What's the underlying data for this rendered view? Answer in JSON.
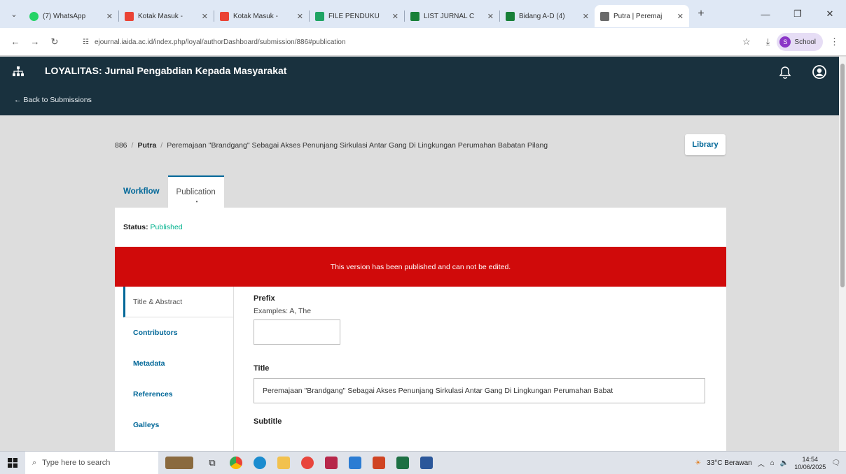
{
  "browser": {
    "tabs": [
      {
        "label": "(7) WhatsApp",
        "color": "#25d366"
      },
      {
        "label": "Kotak Masuk -",
        "color": "#ea4335"
      },
      {
        "label": "Kotak Masuk -",
        "color": "#ea4335"
      },
      {
        "label": "FILE PENDUKU",
        "color": "#1fa463"
      },
      {
        "label": "LIST JURNAL C",
        "color": "#188038"
      },
      {
        "label": "Bidang A-D (4)",
        "color": "#188038"
      },
      {
        "label": "Putra | Peremaj",
        "color": "#6b6b6b"
      }
    ],
    "url": "ejournal.iaida.ac.id/index.php/loyal/authorDashboard/submission/886#publication",
    "profile_label": "School",
    "profile_initial": "S"
  },
  "header": {
    "journal_title": "LOYALITAS: Jurnal Pengabdian Kepada Masyarakat",
    "back_link": "← Back to Submissions"
  },
  "breadcrumb": {
    "id": "886",
    "author": "Putra",
    "title": "Peremajaan \"Brandgang\" Sebagai Akses Penunjang Sirkulasi Antar Gang Di Lingkungan Perumahan Babatan Pilang"
  },
  "library_label": "Library",
  "tabs": {
    "workflow": "Workflow",
    "publication": "Publication"
  },
  "status": {
    "label": "Status:",
    "value": "Published"
  },
  "alert_message": "This version has been published and can not be edited.",
  "sidenav": [
    "Title & Abstract",
    "Contributors",
    "Metadata",
    "References",
    "Galleys"
  ],
  "form": {
    "prefix_label": "Prefix",
    "prefix_desc": "Examples: A, The",
    "prefix_value": "",
    "title_label": "Title",
    "title_value": "Peremajaan \"Brandgang\" Sebagai Akses Penunjang Sirkulasi Antar Gang Di Lingkungan Perumahan Babat",
    "subtitle_label": "Subtitle"
  },
  "taskbar": {
    "search_placeholder": "Type here to search",
    "weather": "33°C Berawan",
    "time": "14:54",
    "date": "10/06/2025"
  }
}
